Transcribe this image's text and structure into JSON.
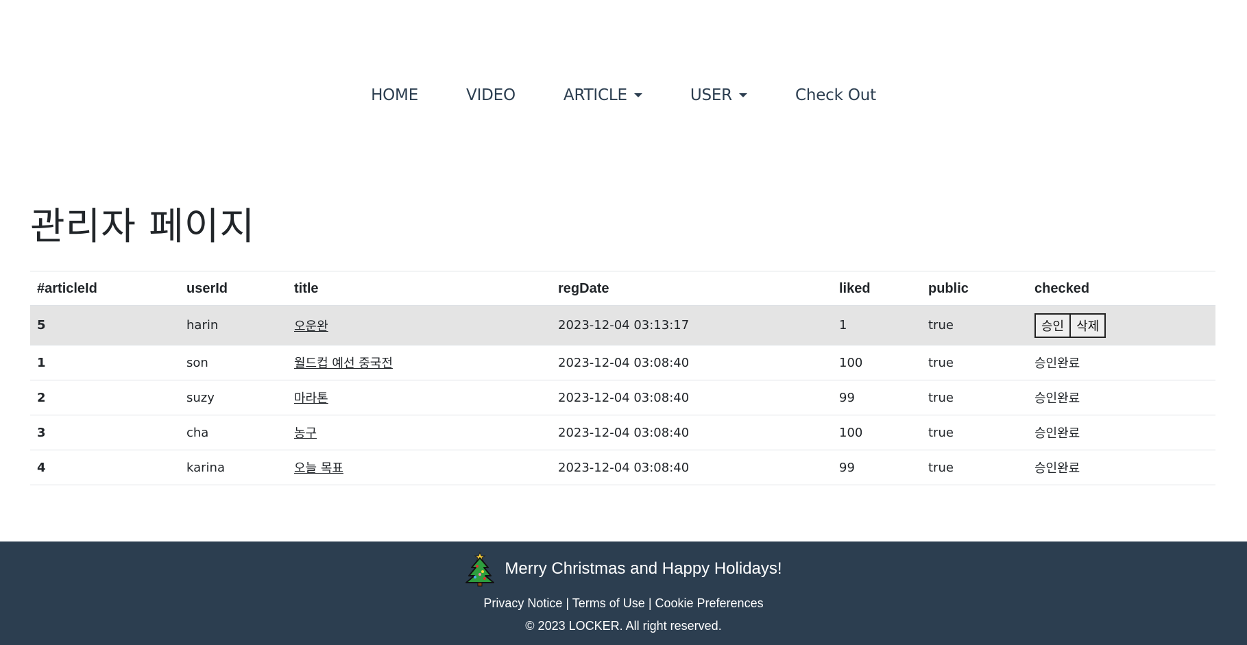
{
  "nav": {
    "items": [
      {
        "label": "HOME",
        "dropdown": false
      },
      {
        "label": "VIDEO",
        "dropdown": false
      },
      {
        "label": "ARTICLE",
        "dropdown": true
      },
      {
        "label": "USER",
        "dropdown": true
      },
      {
        "label": "Check Out",
        "dropdown": false
      }
    ]
  },
  "page_title": "관리자 페이지",
  "table": {
    "headers": [
      "#articleId",
      "userId",
      "title",
      "regDate",
      "liked",
      "public",
      "checked"
    ],
    "rows": [
      {
        "articleId": "5",
        "userId": "harin",
        "title": "오운완",
        "regDate": "2023-12-04 03:13:17",
        "liked": "1",
        "public": "true",
        "checked": null,
        "approve_label": "승인",
        "delete_label": "삭제"
      },
      {
        "articleId": "1",
        "userId": "son",
        "title": "월드컵 예선 중국전",
        "regDate": "2023-12-04 03:08:40",
        "liked": "100",
        "public": "true",
        "checked": "승인완료"
      },
      {
        "articleId": "2",
        "userId": "suzy",
        "title": "마라톤",
        "regDate": "2023-12-04 03:08:40",
        "liked": "99",
        "public": "true",
        "checked": "승인완료"
      },
      {
        "articleId": "3",
        "userId": "cha",
        "title": "농구",
        "regDate": "2023-12-04 03:08:40",
        "liked": "100",
        "public": "true",
        "checked": "승인완료"
      },
      {
        "articleId": "4",
        "userId": "karina",
        "title": "오늘 목표",
        "regDate": "2023-12-04 03:08:40",
        "liked": "99",
        "public": "true",
        "checked": "승인완료"
      }
    ]
  },
  "footer": {
    "greeting": "Merry Christmas and Happy Holidays!",
    "tree_icon": "christmas-tree-icon",
    "links": [
      "Privacy Notice",
      "Terms of Use",
      "Cookie Preferences"
    ],
    "separator": " | ",
    "copyright": "© 2023 LOCKER. All right reserved.",
    "bg_color": "#2c3e50"
  }
}
